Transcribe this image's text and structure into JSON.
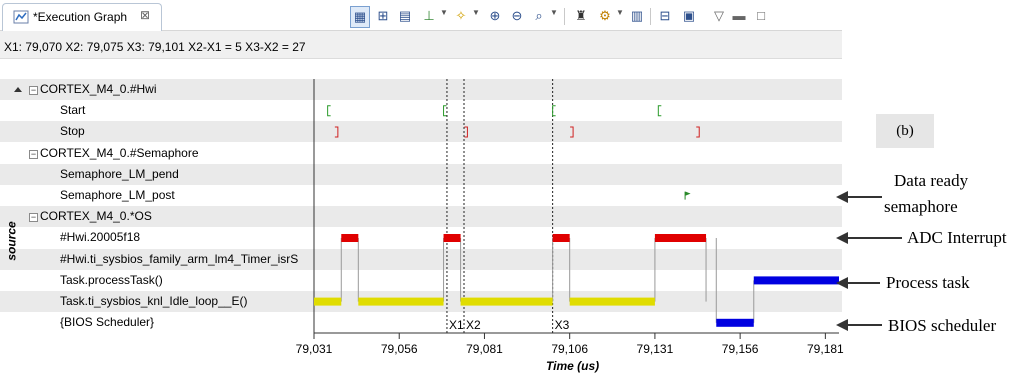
{
  "tab": {
    "title": "*Execution Graph",
    "close_glyph": "⊠"
  },
  "cursor_info": "X1: 79,070  X2: 79,075  X3: 79,101  X2-X1 = 5  X3-X2 = 27",
  "source_label": "source",
  "rows": [
    {
      "label": "CORTEX_M4_0.#Hwi",
      "group": true
    },
    {
      "label": "Start",
      "group": false
    },
    {
      "label": "Stop",
      "group": false
    },
    {
      "label": "CORTEX_M4_0.#Semaphore",
      "group": true
    },
    {
      "label": "Semaphore_LM_pend",
      "group": false
    },
    {
      "label": "Semaphore_LM_post",
      "group": false
    },
    {
      "label": "CORTEX_M4_0.*OS",
      "group": true
    },
    {
      "label": "#Hwi.20005f18",
      "group": false
    },
    {
      "label": "#Hwi.ti_sysbios_family_arm_lm4_Timer_isrS",
      "group": false
    },
    {
      "label": "Task.processTask()",
      "group": false
    },
    {
      "label": "Task.ti_sysbios_knl_Idle_loop__E()",
      "group": false
    },
    {
      "label": "{BIOS Scheduler}",
      "group": false
    }
  ],
  "axis": {
    "label": "Time (us)",
    "ticks": [
      "79,031",
      "79,056",
      "79,081",
      "79,106",
      "79,131",
      "79,156",
      "79,181"
    ],
    "tick_values": [
      79031,
      79056,
      79081,
      79106,
      79131,
      79156,
      79181
    ],
    "range": [
      79031,
      79185
    ]
  },
  "markers": [
    {
      "label": "X1",
      "time": 79070
    },
    {
      "label": "X2",
      "time": 79075
    },
    {
      "label": "X3",
      "time": 79101
    }
  ],
  "events": {
    "start": [
      79035,
      79069,
      79101,
      79132
    ],
    "stop": [
      79038,
      79076,
      79107,
      79144
    ],
    "semaphore_post": [
      79140
    ]
  },
  "segments": {
    "hwi": {
      "color": "#e00000",
      "spans": [
        [
          79039,
          79044
        ],
        [
          79069,
          79074
        ],
        [
          79101,
          79106
        ],
        [
          79131,
          79146
        ]
      ]
    },
    "idle": {
      "color": "#e0dc00",
      "spans": [
        [
          79031,
          79039
        ],
        [
          79044,
          79069
        ],
        [
          79074,
          79101
        ],
        [
          79106,
          79131
        ]
      ]
    },
    "process_task": {
      "color": "#0000e0",
      "spans": [
        [
          79160,
          79185
        ]
      ]
    },
    "bios_scheduler": {
      "color": "#0000e0",
      "spans": [
        [
          79149,
          79160
        ]
      ]
    }
  },
  "annotations": {
    "panel_label": "(b)",
    "data_ready": "Data ready semaphore",
    "adc_interrupt": "ADC Interrupt",
    "process_task": "Process task",
    "bios_scheduler": "BIOS scheduler"
  },
  "colors": {
    "hwi": "#e00000",
    "idle": "#e0dc00",
    "task": "#0000e0",
    "start_event": "#2a9a2a",
    "stop_event": "#d02020",
    "post_event": "#2a8a2a"
  }
}
